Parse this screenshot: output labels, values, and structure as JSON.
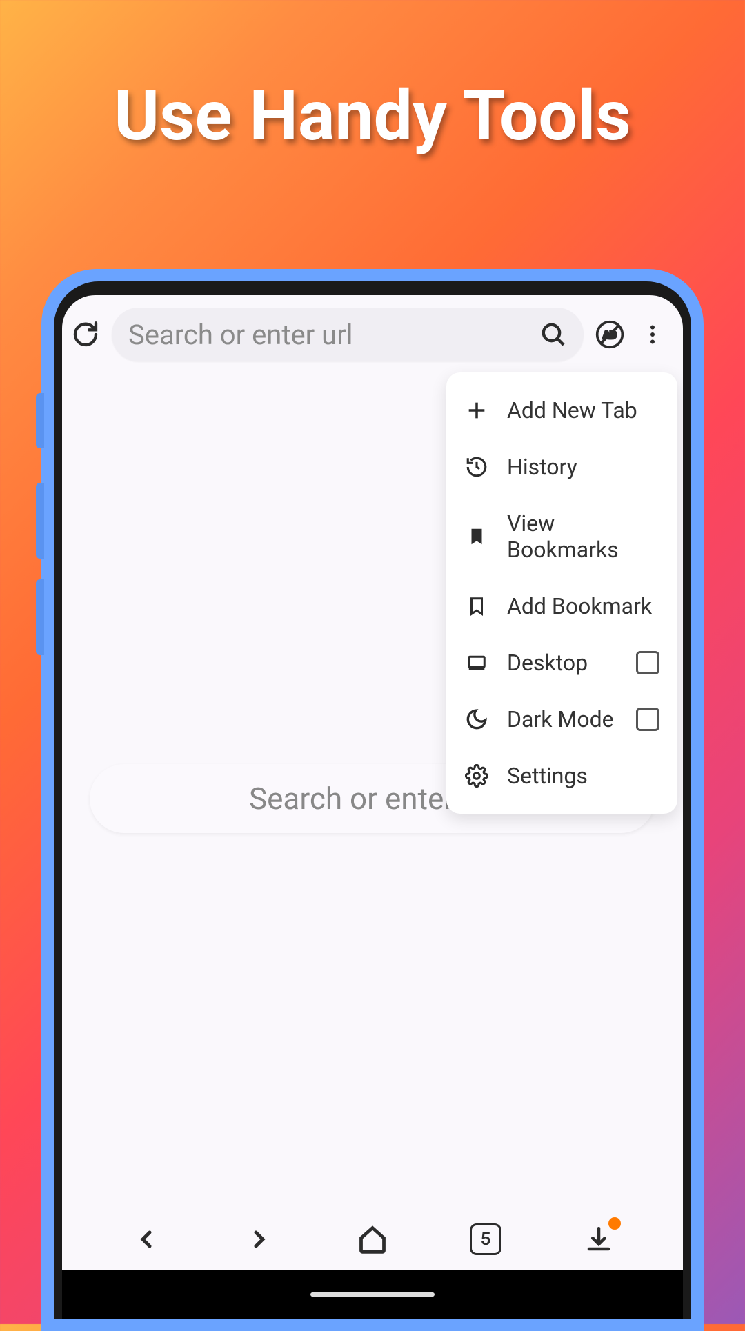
{
  "hero": {
    "title": "Use Handy Tools"
  },
  "topbar": {
    "search_placeholder": "Search or enter url"
  },
  "mid_search": {
    "placeholder": "Search or enter url"
  },
  "menu": {
    "items": [
      {
        "label": "Add New Tab"
      },
      {
        "label": "History"
      },
      {
        "label": "View Bookmarks"
      },
      {
        "label": "Add Bookmark"
      },
      {
        "label": "Desktop",
        "checkbox": true,
        "checked": false
      },
      {
        "label": "Dark Mode",
        "checkbox": true,
        "checked": false
      },
      {
        "label": "Settings"
      }
    ]
  },
  "bottom": {
    "tab_count": "5"
  }
}
